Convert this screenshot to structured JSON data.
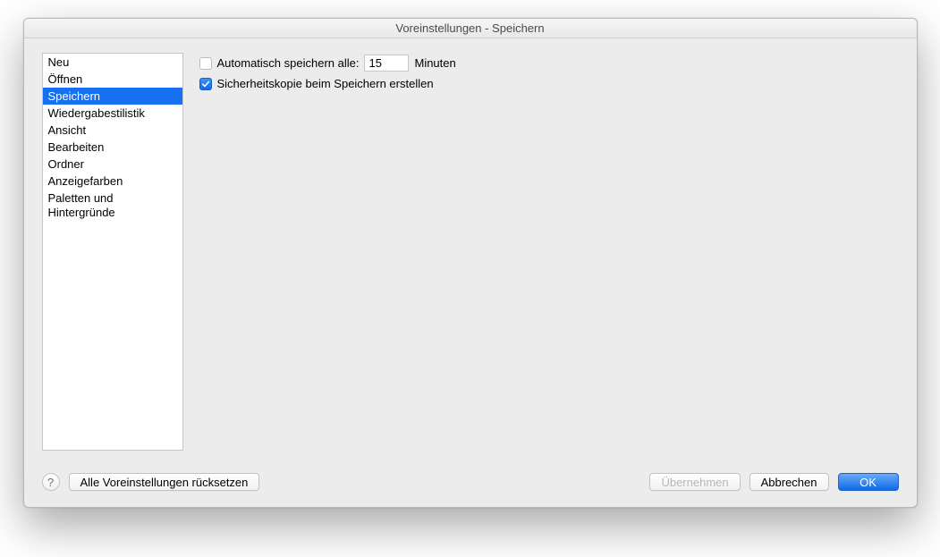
{
  "window": {
    "title": "Voreinstellungen - Speichern"
  },
  "sidebar": {
    "items": [
      {
        "label": "Neu",
        "selected": false
      },
      {
        "label": "Öffnen",
        "selected": false
      },
      {
        "label": "Speichern",
        "selected": true
      },
      {
        "label": "Wiedergabestilistik",
        "selected": false
      },
      {
        "label": "Ansicht",
        "selected": false
      },
      {
        "label": "Bearbeiten",
        "selected": false
      },
      {
        "label": "Ordner",
        "selected": false
      },
      {
        "label": "Anzeigefarben",
        "selected": false
      },
      {
        "label": "Paletten und Hintergründe",
        "selected": false
      }
    ]
  },
  "settings": {
    "autosave": {
      "checked": false,
      "label": "Automatisch speichern alle:",
      "value": "15",
      "unit": "Minuten"
    },
    "backup": {
      "checked": true,
      "label": "Sicherheitskopie beim Speichern erstellen"
    }
  },
  "footer": {
    "help": "?",
    "reset": "Alle Voreinstellungen rücksetzen",
    "apply": "Übernehmen",
    "cancel": "Abbrechen",
    "ok": "OK"
  }
}
